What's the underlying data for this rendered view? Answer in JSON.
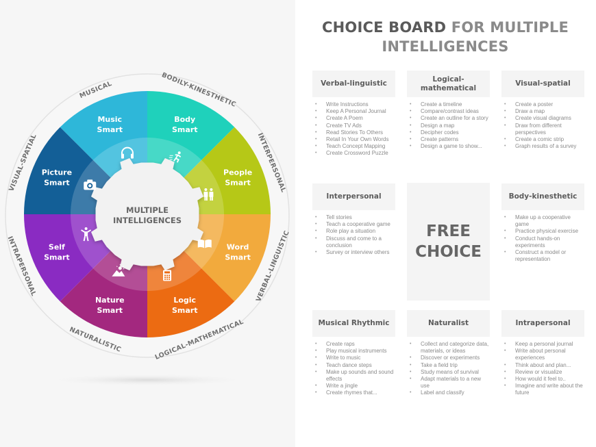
{
  "title": {
    "part_dark": "CHOICE BOARD",
    "part_light": "FOR MULTIPLE INTELLIGENCES"
  },
  "wheel": {
    "center_label_line1": "MULTIPLE",
    "center_label_line2": "INTELLIGENCES",
    "segments": [
      {
        "key": "music",
        "line1": "Music",
        "line2": "Smart",
        "icon": "headphones-icon",
        "color": "#2eb7d9",
        "ring_label": "MUSICAL"
      },
      {
        "key": "body",
        "line1": "Body",
        "line2": "Smart",
        "icon": "running-person-icon",
        "color": "#1fd1bb",
        "ring_label": "BODILY-KINESTHETIC"
      },
      {
        "key": "people",
        "line1": "People",
        "line2": "Smart",
        "icon": "two-people-icon",
        "color": "#b6c817",
        "ring_label": "INTERPERSONAL"
      },
      {
        "key": "word",
        "line1": "Word",
        "line2": "Smart",
        "icon": "open-book-icon",
        "color": "#f2aa3d",
        "ring_label": "VERBAL-LINGUISTIC"
      },
      {
        "key": "logic",
        "line1": "Logic",
        "line2": "Smart",
        "icon": "calculator-icon",
        "color": "#ec6b12",
        "ring_label": "LOGICAL-MATHEMATICAL"
      },
      {
        "key": "nature",
        "line1": "Nature",
        "line2": "Smart",
        "icon": "mountain-sun-icon",
        "color": "#a3287f",
        "ring_label": "NATURALISTIC"
      },
      {
        "key": "self",
        "line1": "Self",
        "line2": "Smart",
        "icon": "person-arms-up-icon",
        "color": "#8a2bc2",
        "ring_label": "INTRAPERSONAL"
      },
      {
        "key": "picture",
        "line1": "Picture",
        "line2": "Smart",
        "icon": "camera-icon",
        "color": "#135f97",
        "ring_label": "VISUAL-SPATIAL"
      }
    ]
  },
  "board": {
    "free_choice_line1": "FREE",
    "free_choice_line2": "CHOICE",
    "cards": [
      {
        "title": "Verbal-linguistic",
        "items": [
          "Write  Instructions",
          "Keep A Personal  Journal",
          "Create A Poem",
          "Create TV Ads",
          "Read Stories To Others",
          "Retail In  Your Own Words",
          "Teach Concept  Mapping",
          "Create Crossword  Puzzle"
        ]
      },
      {
        "title": "Logical-mathematical",
        "items": [
          "Create a timeline",
          "Compare/contrast  ideas",
          "Create an outline  for a story",
          "Design  a map",
          "Decipher  codes",
          "Create patterns",
          "Design  a game to show..."
        ]
      },
      {
        "title": "Visual-spatial",
        "items": [
          "Create a poster",
          "Draw a map",
          "Create visual  diagrams",
          "Draw from  different perspectives",
          "Create a comic  strip",
          "Graph results  of a survey"
        ]
      },
      {
        "title": "Interpersonal",
        "items": [
          "Tell stories",
          "Teach a cooperative game",
          "Role  play a situation",
          "Discuss  and come to a conclusion",
          "Survey  or  interview  others"
        ]
      },
      {
        "title": "Body-kinesthetic",
        "items": [
          "Make up a cooperative game",
          "Practice physical  exercise",
          "Conduct  hands-on experiments",
          "Construct  a model  or representation"
        ]
      },
      {
        "title": "Musical  Rhythmic",
        "items": [
          "Create raps",
          "Play  musical  instruments",
          "Write  to music",
          "Teach dance  steps",
          "Make  up sounds  and sound effects",
          "Write  a jingle",
          "Create rhymes that..."
        ]
      },
      {
        "title": "Naturalist",
        "items": [
          "Collect and categorize  data, materials, or ideas",
          "Discover  or experiments",
          "Take a field trip",
          "Study  means of survival",
          "Adapt materials to a new use",
          "Label and classify"
        ]
      },
      {
        "title": "Intrapersonal",
        "items": [
          "Keep a personal  journal",
          "Write  about personal experiences",
          "Think about and plan...",
          "Review or visualize",
          "How would  it feel to..",
          "Imagine  and write about the future"
        ]
      }
    ]
  }
}
